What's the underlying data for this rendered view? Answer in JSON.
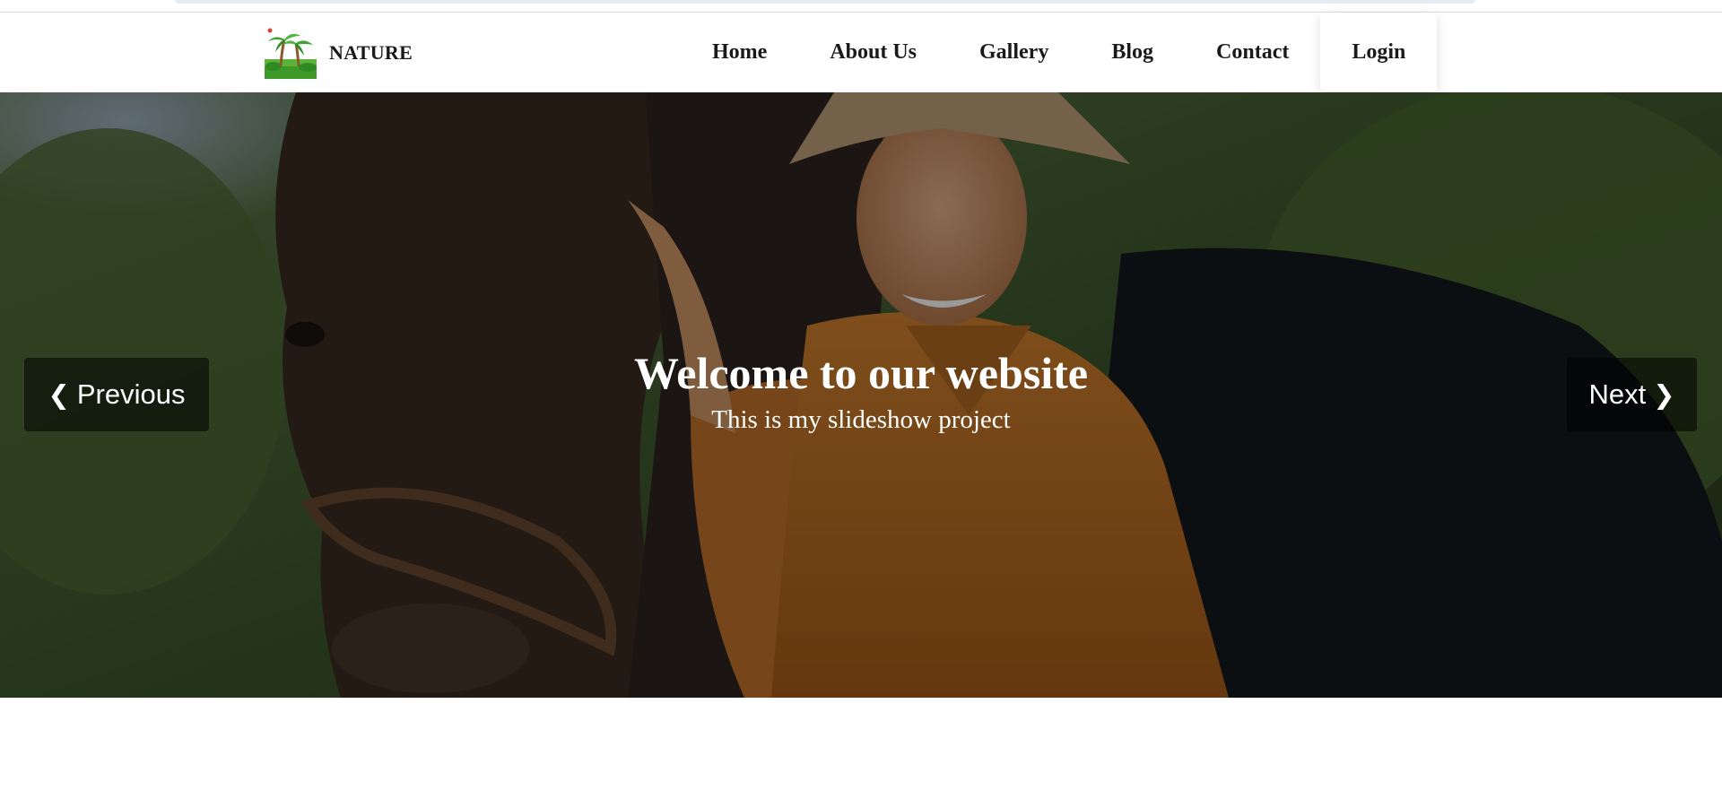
{
  "brand": {
    "name": "NATURE",
    "logo_icon": "palm-trees-logo"
  },
  "nav": {
    "items": [
      {
        "label": "Home"
      },
      {
        "label": "About Us"
      },
      {
        "label": "Gallery"
      },
      {
        "label": "Blog"
      },
      {
        "label": "Contact"
      },
      {
        "label": "Login"
      }
    ],
    "active_index": 5
  },
  "slideshow": {
    "title": "Welcome to our website",
    "subtitle": "This is my slideshow project",
    "prev_label": "Previous",
    "next_label": "Next",
    "prev_icon": "chevron-left-icon",
    "next_icon": "chevron-right-icon"
  },
  "colors": {
    "text": "#1a1a1a",
    "overlay": "rgba(0,0,0,0.40)",
    "button_bg": "rgba(0,0,0,0.55)",
    "caption": "#ffffff"
  }
}
